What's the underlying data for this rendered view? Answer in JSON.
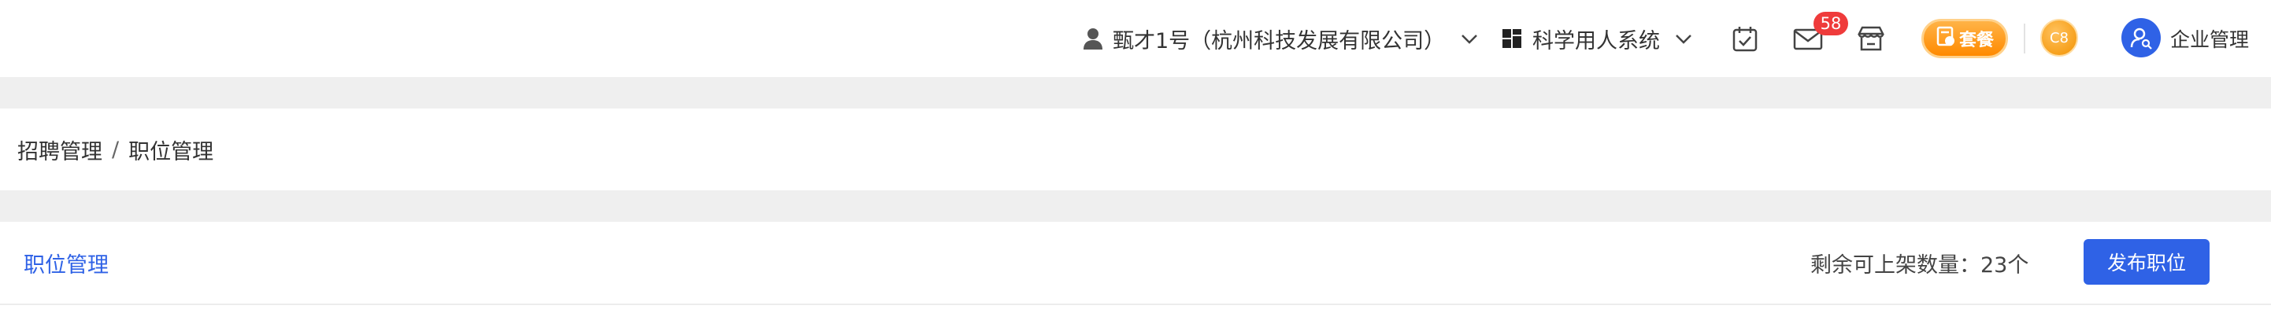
{
  "header": {
    "company": "甄才1号（杭州科技发展有限公司）",
    "system": "科学用人系统",
    "mail_badge": "58",
    "package_label": "套餐",
    "coin_label": "C8",
    "enterprise_label": "企业管理"
  },
  "breadcrumb": {
    "items": [
      "招聘管理",
      "职位管理"
    ],
    "separator": "/"
  },
  "content": {
    "title": "职位管理",
    "remaining_text": "剩余可上架数量：23个",
    "publish_button": "发布职位"
  },
  "colors": {
    "accent": "#2f62e6",
    "badge": "#ef3b3b",
    "package": "#ff8a00"
  },
  "icons": [
    "user-icon",
    "chevron-down-icon",
    "grid-icon",
    "calendar-check-icon",
    "mail-icon",
    "store-icon",
    "package-icon",
    "coin-icon",
    "user-search-icon"
  ]
}
